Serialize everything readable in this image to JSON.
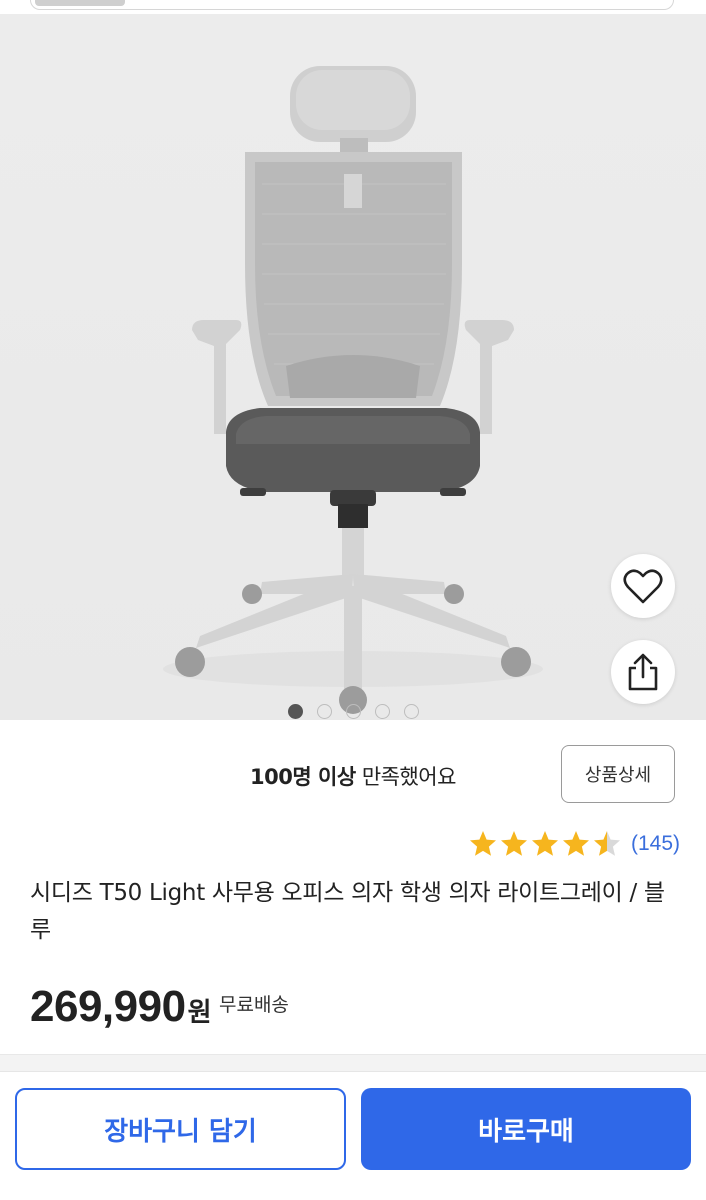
{
  "product": {
    "satisfaction_bold": "100명 이상",
    "satisfaction_rest": " 만족했어요",
    "detail_button": "상품상세",
    "rating_value": 4.5,
    "review_count": "(145)",
    "title": "시디즈 T50 Light 사무용 오피스 의자 학생 의자 라이트그레이 / 블루",
    "price": "269,990",
    "currency": "원",
    "shipping": "무료배송"
  },
  "gallery": {
    "image_count": 5,
    "active_index": 2
  },
  "actions": {
    "cart_label": "장바구니 담기",
    "buy_label": "바로구매"
  },
  "icons": {
    "wishlist": "heart-icon",
    "share": "share-icon",
    "star": "star-icon"
  },
  "colors": {
    "accent": "#2f68e8",
    "star": "#f6b51e",
    "review_count": "#3a6edc"
  }
}
